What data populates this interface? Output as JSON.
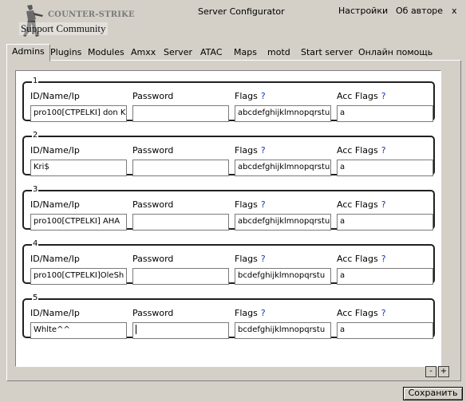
{
  "logo": {
    "title": "COUNTER-STRIKE",
    "subtitle": "Support Community"
  },
  "window": {
    "title": "Server Configurator",
    "close_label": "x"
  },
  "menu": {
    "settings": "Настройки",
    "about": "Об авторе"
  },
  "tabs": [
    "Admins",
    "Plugins",
    "Modules",
    "Amxx",
    "Server",
    "ATAC",
    "Maps",
    "motd",
    "Start server",
    "Онлайн помощь"
  ],
  "active_tab": "Admins",
  "labels": {
    "id": "ID/Name/Ip",
    "password": "Password",
    "flags": "Flags",
    "acc_flags": "Acc Flags",
    "help": "?"
  },
  "admins": [
    {
      "num": "1",
      "id": "pro100[CTPELKI] don K",
      "password": "",
      "flags": "abcdefghijklmnopqrstu",
      "acc_flags": "a"
    },
    {
      "num": "2",
      "id": "Kri$",
      "password": "",
      "flags": "abcdefghijklmnopqrstu",
      "acc_flags": "a"
    },
    {
      "num": "3",
      "id": "pro100[CTPELKI] AHA",
      "password": "",
      "flags": "abcdefghijklmnopqrstu",
      "acc_flags": "a"
    },
    {
      "num": "4",
      "id": "pro100[CTPELKI]OleSh",
      "password": "",
      "flags": "bcdefghijklmnopqrstu",
      "acc_flags": "a"
    },
    {
      "num": "5",
      "id": "Whlte^^",
      "password": "",
      "flags": "bcdefghijklmnopqrstu",
      "acc_flags": "a"
    }
  ],
  "buttons": {
    "minus": "-",
    "plus": "+",
    "save": "Сохранить"
  }
}
